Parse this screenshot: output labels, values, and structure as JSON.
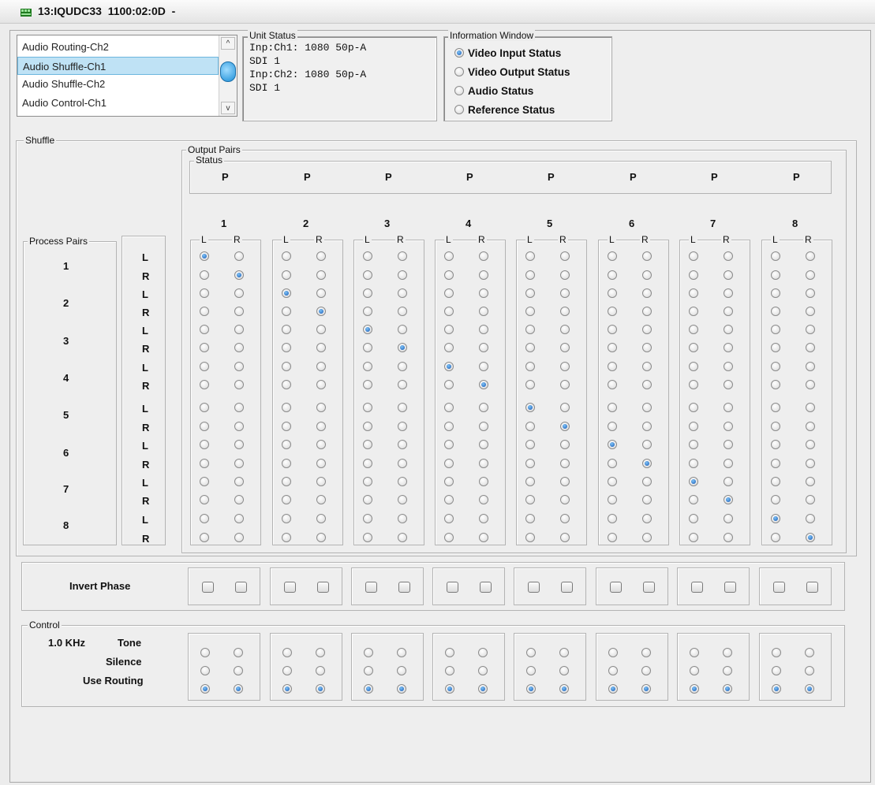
{
  "window": {
    "title": "13:IQUDC33  1100:02:0D  -"
  },
  "colors": {
    "accent": "#1558b5",
    "selection": "#bfe2f5"
  },
  "icons": {
    "title": "card-icon",
    "scroll_up": "chevron-up-icon",
    "scroll_down": "chevron-down-icon"
  },
  "list": {
    "items": [
      "Audio Routing-Ch2",
      "Audio Shuffle-Ch1",
      "Audio Shuffle-Ch2",
      "Audio Control-Ch1"
    ],
    "selected_index": 1,
    "scroll_up": "^",
    "scroll_down": "v"
  },
  "unit_status": {
    "title": "Unit Status",
    "lines": [
      "Inp:Ch1: 1080 50p-A",
      "SDI 1",
      "Inp:Ch2: 1080 50p-A",
      "SDI 1"
    ]
  },
  "info_window": {
    "title": "Information Window",
    "options": [
      "Video Input Status",
      "Video Output Status",
      "Audio Status",
      "Reference Status"
    ],
    "selected_index": 0
  },
  "shuffle": {
    "title": "Shuffle",
    "output_pairs_title": "Output Pairs",
    "status_title": "Status",
    "status_values": [
      "P",
      "P",
      "P",
      "P",
      "P",
      "P",
      "P",
      "P"
    ],
    "pair_numbers": [
      "1",
      "2",
      "3",
      "4",
      "5",
      "6",
      "7",
      "8"
    ],
    "lr_labels": [
      "L",
      "R"
    ],
    "process_pairs_title": "Process Pairs",
    "process_pair_numbers": [
      "1",
      "2",
      "3",
      "4",
      "5",
      "6",
      "7",
      "8"
    ],
    "row_labels": [
      "L",
      "R",
      "L",
      "R",
      "L",
      "R",
      "L",
      "R",
      "L",
      "R",
      "L",
      "R",
      "L",
      "R",
      "L",
      "R"
    ],
    "selected_rows_per_column": [
      0,
      1,
      2,
      3,
      4,
      5,
      6,
      7,
      8,
      9,
      10,
      11,
      12,
      13,
      14,
      15
    ]
  },
  "invert_phase": {
    "label": "Invert Phase",
    "checked": [
      false,
      false,
      false,
      false,
      false,
      false,
      false,
      false,
      false,
      false,
      false,
      false,
      false,
      false,
      false,
      false
    ]
  },
  "control": {
    "title": "Control",
    "label_freq": "1.0 KHz",
    "label_tone": "Tone",
    "label_silence": "Silence",
    "label_routing": "Use Routing",
    "selected_row": 2
  }
}
